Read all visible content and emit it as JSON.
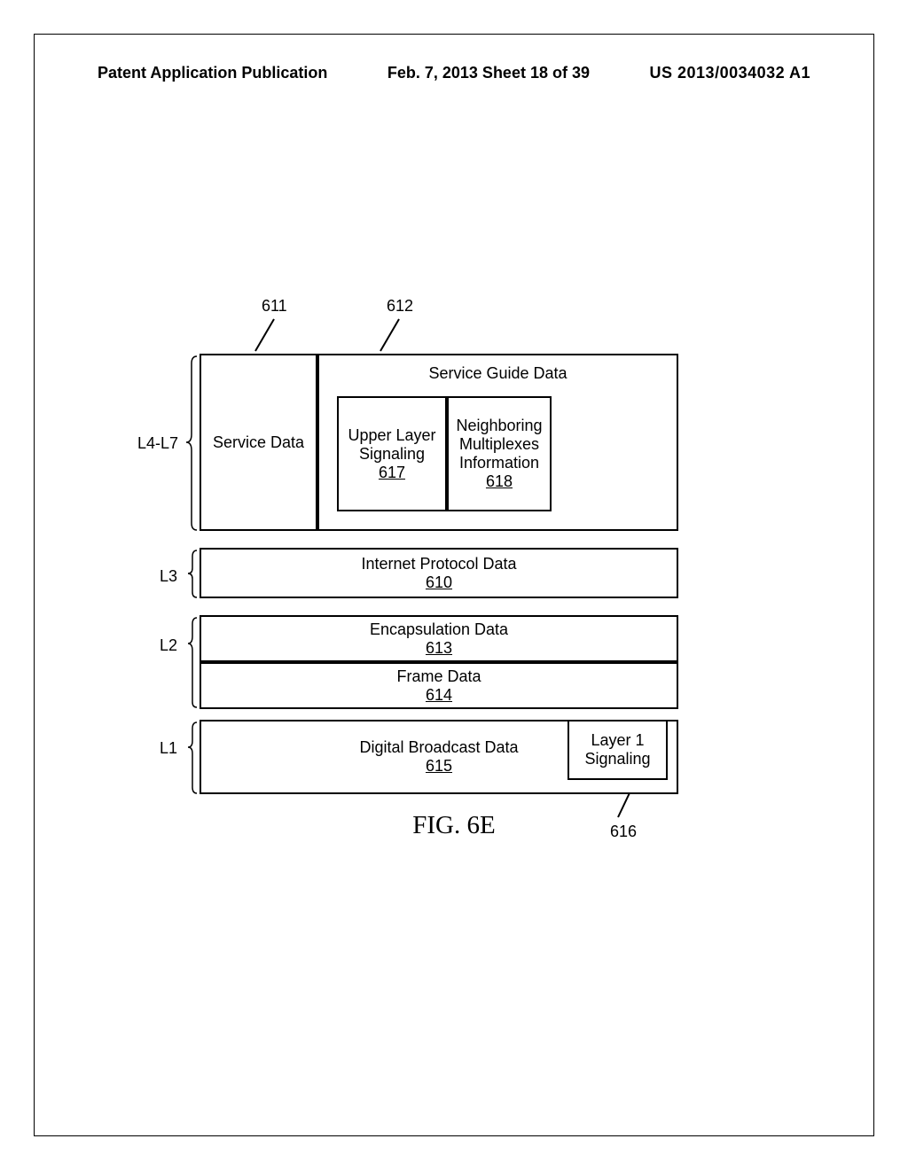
{
  "header": {
    "left": "Patent Application Publication",
    "center": "Feb. 7, 2013  Sheet 18 of 39",
    "right": "US 2013/0034032 A1"
  },
  "refs": {
    "r611": "611",
    "r612": "612",
    "r616": "616",
    "r617": "617",
    "r618": "618",
    "r610": "610",
    "r613": "613",
    "r614": "614",
    "r615": "615"
  },
  "layers": {
    "l4l7": "L4-L7",
    "l3": "L3",
    "l2": "L2",
    "l1": "L1"
  },
  "blocks": {
    "serviceData": "Service Data",
    "serviceGuide": "Service Guide Data",
    "upperLayer": "Upper Layer Signaling",
    "neighboring": "Neighboring Multiplexes Information",
    "ipData": "Internet Protocol Data",
    "encapData": "Encapsulation Data",
    "frameData": "Frame Data",
    "digitalBroadcast": "Digital Broadcast Data",
    "layer1Sig": "Layer 1 Signaling"
  },
  "figure": {
    "caption": "FIG. 6E"
  }
}
